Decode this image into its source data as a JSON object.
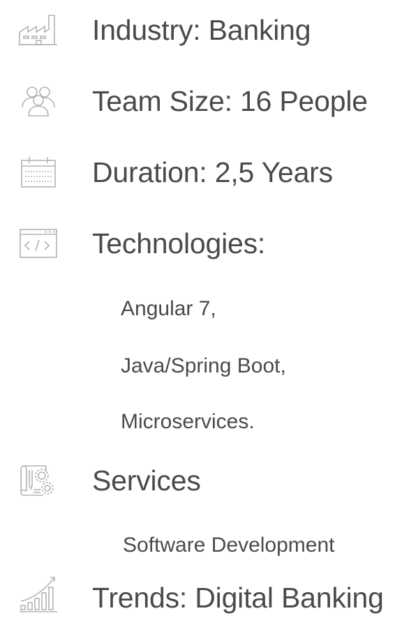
{
  "items": [
    {
      "icon": "factory-icon",
      "label": "Industry: Banking"
    },
    {
      "icon": "team-icon",
      "label": "Team Size: 16 People"
    },
    {
      "icon": "calendar-icon",
      "label": "Duration: 2,5 Years"
    },
    {
      "icon": "code-window-icon",
      "label": "Technologies:"
    },
    {
      "icon": "services-blueprint-icon",
      "label": "Services"
    },
    {
      "icon": "growth-chart-icon",
      "label": "Trends: Digital Banking"
    }
  ],
  "technologies": [
    "Angular 7,",
    "Java/Spring Boot,",
    "Microservices."
  ],
  "services": [
    "Software Development"
  ],
  "colors": {
    "text": "#4a4a4a",
    "icon": "#b3b3b3"
  }
}
